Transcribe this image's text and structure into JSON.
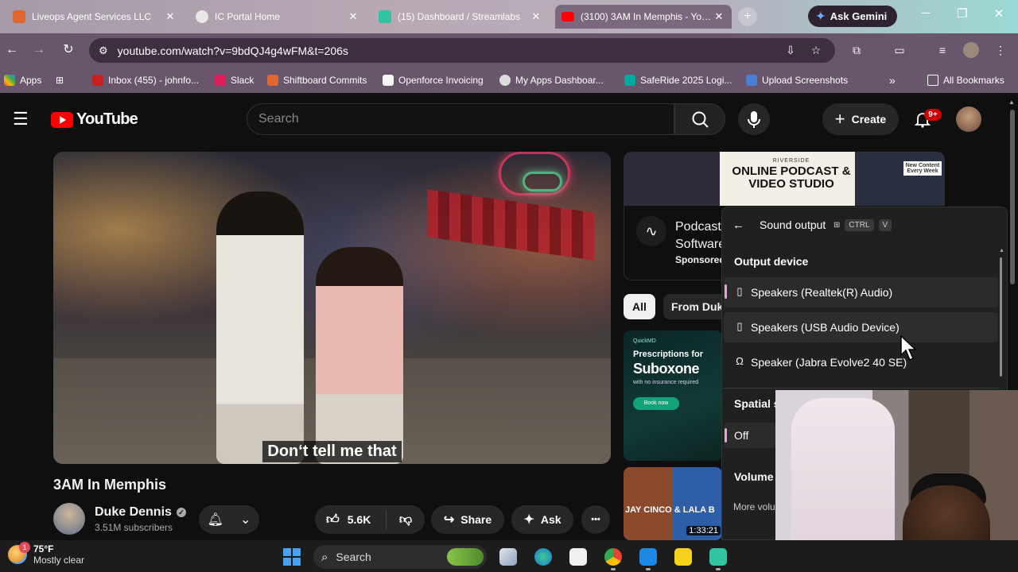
{
  "browser": {
    "tabs": [
      {
        "title": "Liveops Agent Services LLC",
        "color": "#e0662f",
        "active": false
      },
      {
        "title": "IC Portal Home",
        "color": "#e8e8e8",
        "active": false
      },
      {
        "title": "(15) Dashboard / Streamlabs",
        "color": "#31c3a2",
        "active": false
      },
      {
        "title": "(3100) 3AM In Memphis - YouT",
        "color": "#ff0000",
        "active": true
      }
    ],
    "new_tab": "+",
    "gemini_label": "Ask Gemini",
    "window_controls": {
      "minimize": "─",
      "maximize": "❐",
      "close": "✕"
    },
    "url": "youtube.com/watch?v=9bdQJ4g4wFM&t=206s",
    "bookmarks": [
      {
        "label": "Apps",
        "color": "#ea4335"
      },
      {
        "label": "Inbox (455) - johnfo...",
        "color": "#c5221f"
      },
      {
        "label": "Slack",
        "color": "#e01e5a"
      },
      {
        "label": "Shiftboard Commits",
        "color": "#e0662f"
      },
      {
        "label": "Openforce Invoicing",
        "color": "#f5f5f5"
      },
      {
        "label": "My Apps Dashboar...",
        "color": "#dddddd"
      },
      {
        "label": "SafeRide 2025 Logi...",
        "color": "#00a99d"
      },
      {
        "label": "Upload Screenshots",
        "color": "#4a7fd4"
      }
    ],
    "all_bookmarks": "All Bookmarks",
    "more_bookmarks": "»"
  },
  "youtube": {
    "logo_text": "YouTube",
    "search_placeholder": "Search",
    "create_label": "Create",
    "notification_count": "9+",
    "video": {
      "caption": "Don‘t tell me that",
      "title": "3AM In Memphis"
    },
    "channel": {
      "name": "Duke Dennis",
      "subscribers": "3.51M subscribers"
    },
    "actions": {
      "likes": "5.6K",
      "share": "Share",
      "ask": "Ask",
      "more": "•••"
    },
    "ad": {
      "brand": "RIVERSIDE",
      "headline": "ONLINE PODCAST & VIDEO STUDIO",
      "tag": "New Content Every Week",
      "title_partial": "Podcast Software",
      "sponsored": "Sponsored"
    },
    "chips": [
      "All",
      "From Duke"
    ],
    "recommended": [
      {
        "brand": "QuickMD",
        "line1": "Prescriptions for",
        "line2": "Suboxone",
        "line3": "with no insurance required",
        "button": "Book now"
      },
      {
        "title": "JAY CINCO & LALA B",
        "duration": "1:33:21"
      }
    ]
  },
  "sound_panel": {
    "title": "Sound output",
    "shortcut": [
      "CTRL",
      "V"
    ],
    "output_device_heading": "Output device",
    "devices": [
      {
        "label": "Speakers (Realtek(R) Audio)",
        "selected": true
      },
      {
        "label": "Speakers (USB Audio Device)",
        "selected": false
      },
      {
        "label": "Speaker (Jabra Evolve2 40 SE)",
        "selected": false
      }
    ],
    "spatial_heading": "Spatial s",
    "spatial_value": "Off",
    "volume_heading": "Volume",
    "more_volume": "More volu"
  },
  "taskbar": {
    "weather_temp": "75°F",
    "weather_condition": "Mostly clear",
    "weather_badge": "1",
    "search_label": "Search"
  }
}
